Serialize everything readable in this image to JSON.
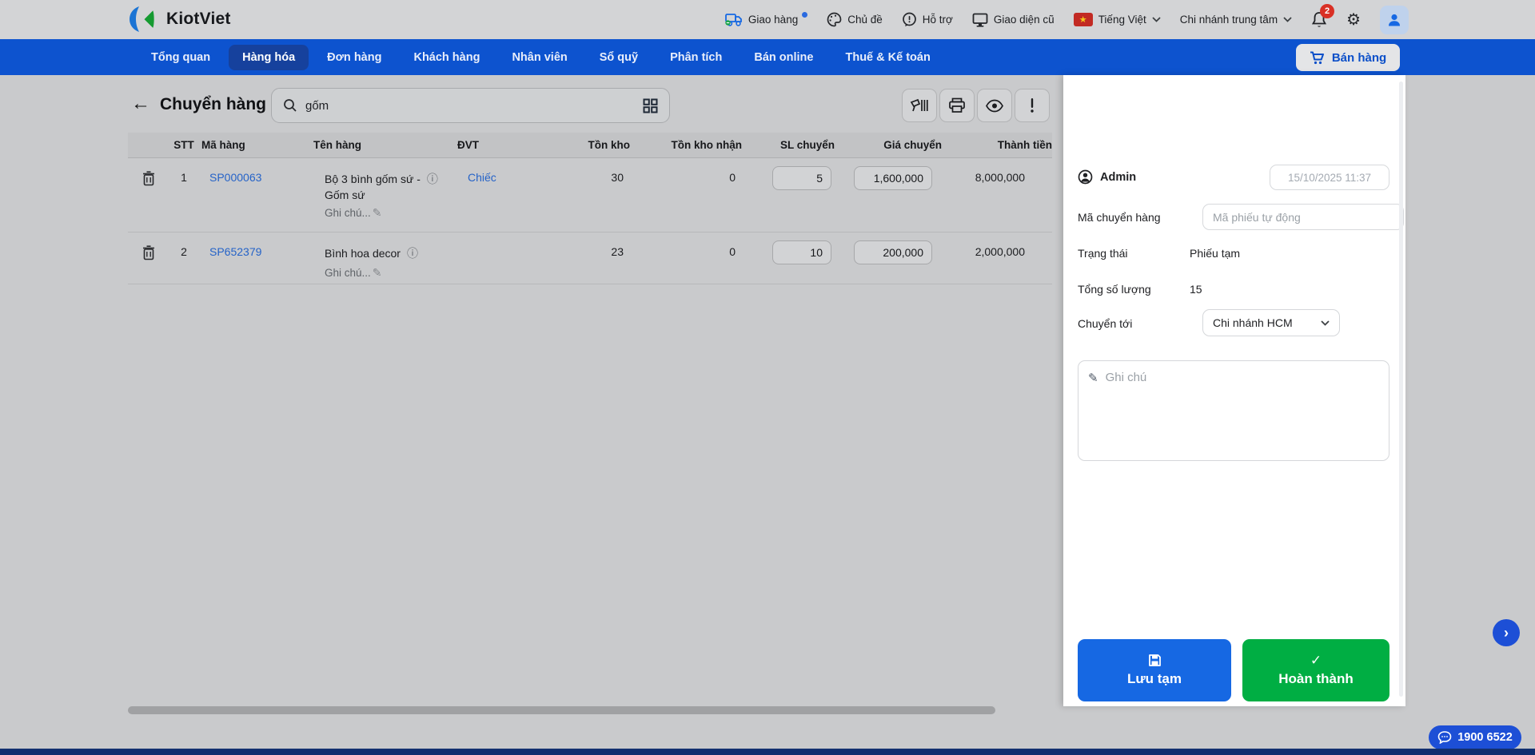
{
  "topbar": {
    "brand": "KiotViet",
    "delivery": "Giao hàng",
    "theme": "Chủ đề",
    "support": "Hỗ trợ",
    "old_ui": "Giao diện cũ",
    "language": "Tiếng Việt",
    "branch": "Chi nhánh trung tâm",
    "notification_count": "2"
  },
  "nav": {
    "items": [
      "Tổng quan",
      "Hàng hóa",
      "Đơn hàng",
      "Khách hàng",
      "Nhân viên",
      "Sổ quỹ",
      "Phân tích",
      "Bán online",
      "Thuế & Kế toán"
    ],
    "active_item": "Hàng hóa",
    "sell_button": "Bán hàng"
  },
  "content": {
    "title": "Chuyển hàng",
    "search_value": "gốm",
    "toolbar_icons": [
      "barcode-scan-icon",
      "print-icon",
      "preview-icon",
      "alert-icon"
    ],
    "table": {
      "headers": [
        "STT",
        "Mã hàng",
        "Tên hàng",
        "ĐVT",
        "Tồn kho",
        "Tồn kho nhận",
        "SL chuyển",
        "Giá chuyển",
        "Thành tiền"
      ],
      "rows": [
        {
          "stt": "1",
          "code": "SP000063",
          "name_line1": "Bộ 3 bình gốm sứ -",
          "name_line2": "Gốm sứ",
          "note": "Ghi chú...",
          "unit": "Chiếc",
          "stock": "30",
          "stock_receive": "0",
          "qty": "5",
          "price": "1,600,000",
          "total": "8,000,000"
        },
        {
          "stt": "2",
          "code": "SP652379",
          "name_line1": "Bình hoa decor",
          "name_line2": "",
          "note": "Ghi chú...",
          "unit": "",
          "stock": "23",
          "stock_receive": "0",
          "qty": "10",
          "price": "200,000",
          "total": "2,000,000"
        }
      ]
    }
  },
  "panel": {
    "user": "Admin",
    "datetime": "15/10/2025 11:37",
    "code_label": "Mã chuyển hàng",
    "code_placeholder": "Mã phiếu tự động",
    "status_label": "Trạng thái",
    "status_value": "Phiếu tạm",
    "quantity_label": "Tổng số lượng",
    "quantity_value": "15",
    "destination_label": "Chuyển tới",
    "destination_value": "Chi nhánh HCM",
    "note_placeholder": "Ghi chú",
    "save_draft_button": "Lưu tạm",
    "complete_button": "Hoàn thành"
  },
  "floating": {
    "hotline": "1900 6522"
  },
  "icons": {
    "back": "←",
    "gear": "⚙",
    "pencil": "✎",
    "info": "ⓘ",
    "check": "✓",
    "chevron_right": "›",
    "star": "★"
  },
  "colors": {
    "nav_blue": "#0d53cf",
    "active_tab": "#16419d",
    "accent_blue": "#1668e3",
    "success_green": "#00ae43",
    "link_blue": "#2563c8",
    "badge_red": "#d93025",
    "fab_blue": "#1d4fd6"
  }
}
